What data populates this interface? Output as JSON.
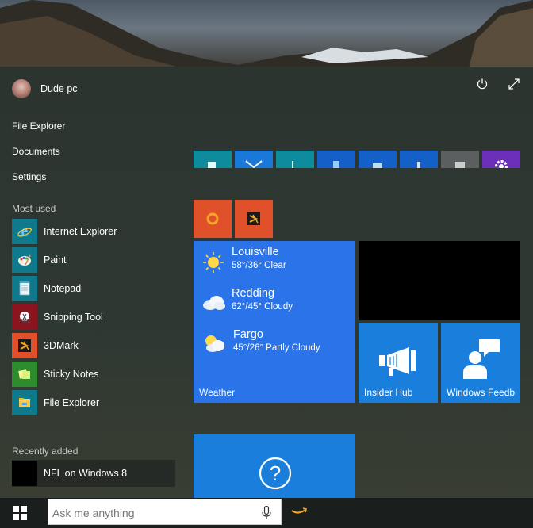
{
  "user": {
    "name": "Dude pc"
  },
  "places": [
    "File Explorer",
    "Documents",
    "Settings"
  ],
  "most_used": {
    "label": "Most used",
    "apps": [
      {
        "name": "Internet Explorer",
        "icon": "internet-explorer-icon",
        "color": "#0e7a8c"
      },
      {
        "name": "Paint",
        "icon": "paint-icon",
        "color": "#0e7a8c"
      },
      {
        "name": "Notepad",
        "icon": "notepad-icon",
        "color": "#0e7a8c"
      },
      {
        "name": "Snipping Tool",
        "icon": "snipping-tool-icon",
        "color": "#8a1420"
      },
      {
        "name": "3DMark",
        "icon": "3dmark-icon",
        "color": "#e0502a"
      },
      {
        "name": "Sticky Notes",
        "icon": "sticky-notes-icon",
        "color": "#2e8b2e"
      },
      {
        "name": "File Explorer",
        "icon": "folder-icon",
        "color": "#0e7a8c"
      }
    ]
  },
  "recently_added": {
    "label": "Recently added",
    "apps": [
      {
        "name": "NFL on Windows 8",
        "icon": "nfl-icon"
      }
    ]
  },
  "weather": {
    "label": "Weather",
    "cities": [
      {
        "city": "Louisville",
        "temp": "58°/36° Clear",
        "icon": "sun-icon"
      },
      {
        "city": "Redding",
        "temp": "62°/45° Cloudy",
        "icon": "cloud-icon"
      },
      {
        "city": "Fargo",
        "temp": "45°/26° Partly Cloudy",
        "icon": "partly-cloudy-icon"
      }
    ]
  },
  "tiles": {
    "insider_hub": "Insider Hub",
    "windows_feedback": "Windows Feedb"
  },
  "search": {
    "placeholder": "Ask me anything"
  },
  "colors": {
    "accent": "#2a73e8",
    "tile_blue": "#1a7fdc",
    "orange": "#e0502a"
  }
}
